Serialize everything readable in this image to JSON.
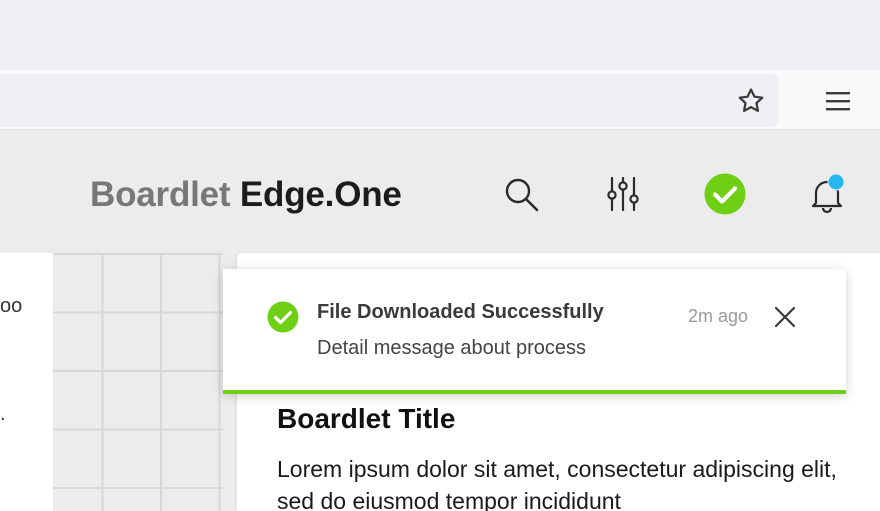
{
  "browser": {
    "bookmark_icon": "star-icon",
    "menu_icon": "hamburger-menu-icon"
  },
  "header": {
    "brand_primary": "Boardlet",
    "brand_secondary": "Edge.One",
    "icons": [
      "search-icon",
      "sliders-icon",
      "check-circle-icon",
      "bell-icon"
    ],
    "notification_dot_color": "#25b8f0",
    "success_color": "#6fcf14"
  },
  "left_panel": {
    "fragment_1": "oo",
    "fragment_2": "."
  },
  "toast": {
    "title": "File Downloaded Successfully",
    "message": "Detail message about process",
    "time": "2m ago",
    "accent_color": "#6fcf14"
  },
  "card": {
    "title": "Boardlet Title",
    "body": "Lorem ipsum dolor sit amet, consectetur adipiscing elit, sed do eiusmod tempor incididunt"
  }
}
